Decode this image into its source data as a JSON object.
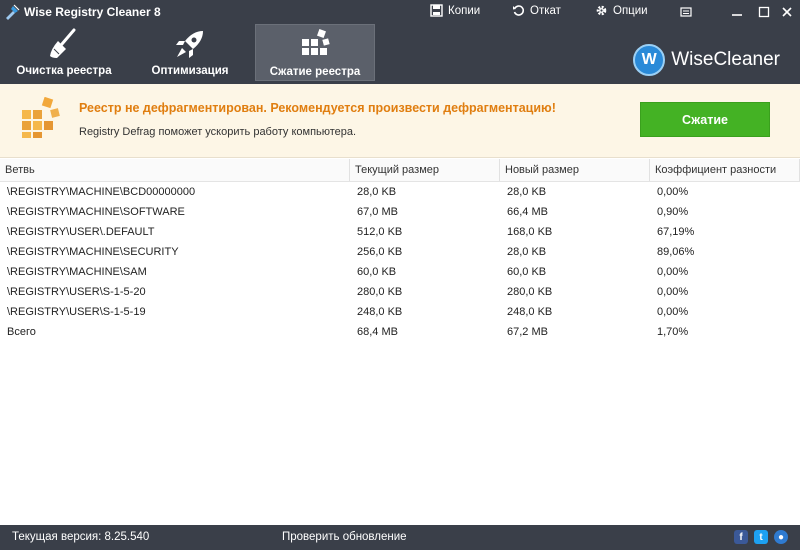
{
  "titlebar": {
    "title": "Wise Registry Cleaner 8",
    "actions": [
      {
        "label": "Копии",
        "icon": "backup-icon"
      },
      {
        "label": "Откат",
        "icon": "restore-icon"
      },
      {
        "label": "Опции",
        "icon": "gear-icon"
      }
    ]
  },
  "toolbar": {
    "tabs": [
      {
        "label": "Очистка реестра",
        "icon": "broom-icon"
      },
      {
        "label": "Оптимизация",
        "icon": "rocket-icon"
      },
      {
        "label": "Сжатие реестра",
        "icon": "blocks-icon",
        "active": true
      }
    ],
    "brand": "WiseCleaner",
    "brand_letter": "W"
  },
  "banner": {
    "title": "Реестр не дефрагментирован. Рекомендуется произвести дефрагментацию!",
    "subtitle": "Registry Defrag поможет ускорить работу компьютера.",
    "button_label": "Сжатие"
  },
  "table": {
    "columns": [
      "Ветвь",
      "Текущий размер",
      "Новый размер",
      "Коэффициент разности"
    ],
    "rows": [
      [
        "\\REGISTRY\\MACHINE\\BCD00000000",
        "28,0 KB",
        "28,0 KB",
        "0,00%"
      ],
      [
        "\\REGISTRY\\MACHINE\\SOFTWARE",
        "67,0 MB",
        "66,4 MB",
        "0,90%"
      ],
      [
        "\\REGISTRY\\USER\\.DEFAULT",
        "512,0 KB",
        "168,0 KB",
        "67,19%"
      ],
      [
        "\\REGISTRY\\MACHINE\\SECURITY",
        "256,0 KB",
        "28,0 KB",
        "89,06%"
      ],
      [
        "\\REGISTRY\\MACHINE\\SAM",
        "60,0 KB",
        "60,0 KB",
        "0,00%"
      ],
      [
        "\\REGISTRY\\USER\\S-1-5-20",
        "280,0 KB",
        "280,0 KB",
        "0,00%"
      ],
      [
        "\\REGISTRY\\USER\\S-1-5-19",
        "248,0 KB",
        "248,0 KB",
        "0,00%"
      ],
      [
        "Всего",
        "68,4 MB",
        "67,2 MB",
        "1,70%"
      ]
    ]
  },
  "status": {
    "version": "Текущая версия: 8.25.540",
    "update": "Проверить обновление",
    "social": [
      "facebook-icon",
      "twitter-icon",
      "globe-icon"
    ]
  },
  "colors": {
    "chrome": "#3a3f49",
    "accent_orange": "#e07e10",
    "button_green": "#44b224",
    "banner_bg": "#fdf6e6"
  }
}
